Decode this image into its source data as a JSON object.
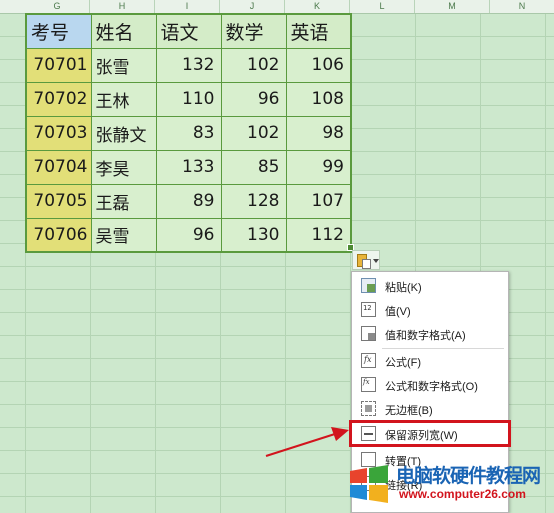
{
  "columns": [
    "G",
    "H",
    "I",
    "J",
    "K",
    "L",
    "M",
    "N"
  ],
  "table": {
    "headers": [
      "考号",
      "姓名",
      "语文",
      "数学",
      "英语"
    ],
    "rows": [
      [
        "70701",
        "张雪",
        "132",
        "102",
        "106"
      ],
      [
        "70702",
        "王林",
        "110",
        "96",
        "108"
      ],
      [
        "70703",
        "张静文",
        "83",
        "102",
        "98"
      ],
      [
        "70704",
        "李昊",
        "133",
        "85",
        "99"
      ],
      [
        "70705",
        "王磊",
        "89",
        "128",
        "107"
      ],
      [
        "70706",
        "吴雪",
        "96",
        "130",
        "112"
      ]
    ]
  },
  "paste_menu": {
    "items": [
      {
        "label": "粘贴(K)",
        "icon": "paste-icon"
      },
      {
        "label": "值(V)",
        "icon": "values-icon"
      },
      {
        "label": "值和数字格式(A)",
        "icon": "values-number-format-icon"
      },
      {
        "label": "公式(F)",
        "icon": "formula-icon"
      },
      {
        "label": "公式和数字格式(O)",
        "icon": "formula-number-format-icon"
      },
      {
        "label": "无边框(B)",
        "icon": "no-borders-icon"
      },
      {
        "label": "保留源列宽(W)",
        "icon": "keep-source-column-width-icon"
      },
      {
        "label": "转置(T)",
        "icon": "transpose-icon"
      },
      {
        "label": "链接(R)",
        "icon": "link-icon"
      }
    ]
  },
  "colors": {
    "highlight": "#d2141d",
    "table_border": "#5a9a3e",
    "id_column": "#e2df78",
    "sheet_background": "#cde8cd"
  },
  "watermark": {
    "title": "电脑软硬件教程网",
    "url": "www.computer26.com"
  }
}
